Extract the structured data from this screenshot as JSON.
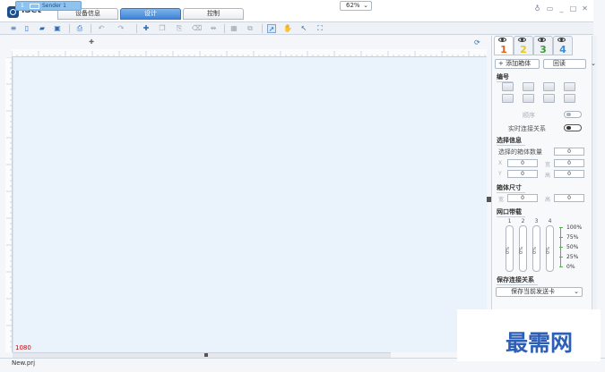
{
  "app": {
    "name": "iSet"
  },
  "nav_tabs": [
    {
      "label": "设备信息"
    },
    {
      "label": "设计"
    },
    {
      "label": "控制"
    }
  ],
  "toolbar": {
    "zoom": "62%"
  },
  "sender_tab": {
    "index": "1",
    "label": "Sender 1"
  },
  "canvas": {
    "corner_label": "1080"
  },
  "status": {
    "file": "New.prj"
  },
  "panel": {
    "tabs": [
      {
        "label": "1",
        "color": "#e0641f"
      },
      {
        "label": "2",
        "color": "#e8c61e"
      },
      {
        "label": "3",
        "color": "#3f9a3a"
      },
      {
        "label": "4",
        "color": "#3a8fd6"
      }
    ],
    "add_box": "+ 添加箱体",
    "readback": "回读",
    "numbering": {
      "title": "编号",
      "order": "顺序",
      "realtime": "实时连接关系"
    },
    "selection": {
      "title": "选择信息",
      "count_label": "选择的箱体数量",
      "count": "0",
      "x": "X",
      "y": "Y",
      "w": "宽",
      "h": "高",
      "x_val": "0",
      "y_val": "0",
      "w_val": "0",
      "h_val": "0"
    },
    "size": {
      "title": "箱体尺寸",
      "w": "宽",
      "h": "高",
      "w_val": "0",
      "h_val": "0"
    },
    "bandwidth": {
      "title": "网口带载",
      "ports": [
        "1",
        "2",
        "3",
        "4"
      ],
      "values": [
        "0%",
        "0%",
        "0%",
        "0%"
      ],
      "scale": [
        "100%",
        "75%",
        "50%",
        "25%",
        "0%"
      ]
    },
    "save": {
      "title": "保存连接关系",
      "button": "保存当前发送卡"
    }
  },
  "watermark": "最需网"
}
